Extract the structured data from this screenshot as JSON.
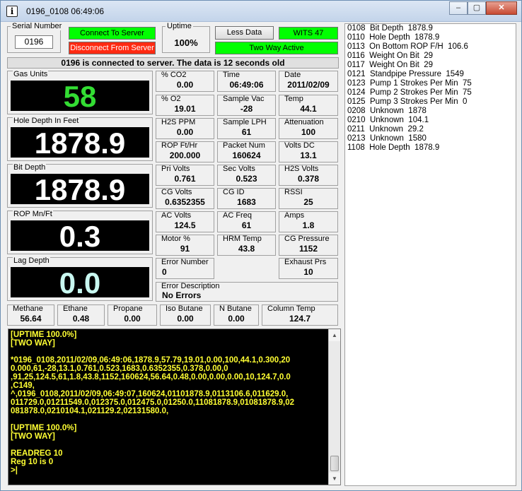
{
  "window": {
    "title": "0196_0108 06:49:06",
    "minimize_glyph": "‒",
    "maximize_glyph": "▢",
    "close_glyph": "✕"
  },
  "header": {
    "serial_label": "Serial Number",
    "serial_value": "0196",
    "connect_label": "Connect To Server",
    "disconnect_label": "Disconnect From Server",
    "uptime_label": "Uptime",
    "uptime_value": "100%",
    "less_data_label": "Less Data",
    "wits_label": "WITS 47",
    "two_way_label": "Two Way Active"
  },
  "status_bar": "0196 is connected to server.  The data is 12 seconds old",
  "big_readouts": [
    {
      "label": "Gas Units",
      "value": "58",
      "color": "#33dd33"
    },
    {
      "label": "Hole Depth In Feet",
      "value": "1878.9",
      "color": "#ffffff"
    },
    {
      "label": "Bit Depth",
      "value": "1878.9",
      "color": "#ffffff"
    },
    {
      "label": "ROP Mn/Ft",
      "value": "0.3",
      "color": "#ffffff"
    },
    {
      "label": "Lag Depth",
      "value": "0.0",
      "color": "#c8f7f0"
    }
  ],
  "fields": {
    "co2": {
      "label": "% CO2",
      "value": "0.00"
    },
    "time": {
      "label": "Time",
      "value": "06:49:06"
    },
    "date": {
      "label": "Date",
      "value": "2011/02/09"
    },
    "o2": {
      "label": "% O2",
      "value": "19.01"
    },
    "sample_vac": {
      "label": "Sample Vac",
      "value": "-28"
    },
    "temp": {
      "label": "Temp",
      "value": "44.1"
    },
    "h2s_ppm": {
      "label": "H2S PPM",
      "value": "0.00"
    },
    "sample_lph": {
      "label": "Sample LPH",
      "value": "61"
    },
    "attenuation": {
      "label": "Attenuation",
      "value": "100"
    },
    "rop_ft_hr": {
      "label": "ROP Ft/Hr",
      "value": "200.000"
    },
    "packet_num": {
      "label": "Packet Num",
      "value": "160624"
    },
    "volts_dc": {
      "label": "Volts DC",
      "value": "13.1"
    },
    "pri_volts": {
      "label": "Pri Volts",
      "value": "0.761"
    },
    "sec_volts": {
      "label": "Sec Volts",
      "value": "0.523"
    },
    "h2s_volts": {
      "label": "H2S Volts",
      "value": "0.378"
    },
    "cg_volts": {
      "label": "CG Volts",
      "value": "0.6352355"
    },
    "cg_id": {
      "label": "CG ID",
      "value": "1683"
    },
    "rssi": {
      "label": "RSSI",
      "value": "25"
    },
    "ac_volts": {
      "label": "AC Volts",
      "value": "124.5"
    },
    "ac_freq": {
      "label": "AC Freq",
      "value": "61"
    },
    "amps": {
      "label": "Amps",
      "value": "1.8"
    },
    "motor": {
      "label": "Motor %",
      "value": "91"
    },
    "hrm_temp": {
      "label": "HRM Temp",
      "value": "43.8"
    },
    "cg_pressure": {
      "label": "CG Pressure",
      "value": "1152"
    },
    "error_number": {
      "label": "Error Number",
      "value": "0"
    },
    "exhaust_prs": {
      "label": "Exhaust Prs",
      "value": "10"
    },
    "error_desc": {
      "label": "Error Description",
      "value": "No Errors"
    },
    "methane": {
      "label": "Methane",
      "value": "56.64"
    },
    "ethane": {
      "label": "Ethane",
      "value": "0.48"
    },
    "propane": {
      "label": "Propane",
      "value": "0.00"
    },
    "iso_butane": {
      "label": "Iso Butane",
      "value": "0.00"
    },
    "n_butane": {
      "label": "N Butane",
      "value": "0.00"
    },
    "column_temp": {
      "label": "Column Temp",
      "value": "124.7"
    }
  },
  "console_lines": [
    "[UPTIME 100.0%]",
    "[TWO WAY]",
    "",
    "*0196_0108,2011/02/09,06:49:06,1878.9,57.79,19.01,0.00,100,44.1,0.300,20",
    "0.000,61,-28,13.1,0.761,0.523,1683,0.6352355,0.378,0.00,0",
    ",91,25,124.5,61,1.8,43.8,1152,160624,56.64,0.48,0.00,0.00,0.00,10,124.7,0.0",
    ",C149,",
    "^,0196_0108,2011/02/09,06:49:07,160624,01101878.9,0113106.6,011629.0,",
    "011729.0,01211549.0,012375.0,012475.0,01250.0,11081878.9,01081878.9,02",
    "081878.0,0210104.1,021129.2,02131580.0,",
    "",
    "[UPTIME 100.0%]",
    "[TWO WAY]",
    "",
    "READREG 10",
    "Reg 10 is 0",
    ">|"
  ],
  "wits_list": [
    "0108  Bit Depth  1878.9",
    "0110  Hole Depth  1878.9",
    "0113  On Bottom ROP F/H  106.6",
    "0116  Weight On Bit  29",
    "0117  Weight On Bit  29",
    "0121  Standpipe Pressure  1549",
    "0123  Pump 1 Strokes Per Min  75",
    "0124  Pump 2 Strokes Per Min  75",
    "0125  Pump 3 Strokes Per Min  0",
    "0208  Unknown  1878",
    "0210  Unknown  104.1",
    "0211  Unknown  29.2",
    "0213  Unknown  1580",
    "1108  Hole Depth  1878.9"
  ],
  "colors": {
    "green": "#00ff00",
    "red": "#ff2a12",
    "console_text": "#ffff33"
  }
}
